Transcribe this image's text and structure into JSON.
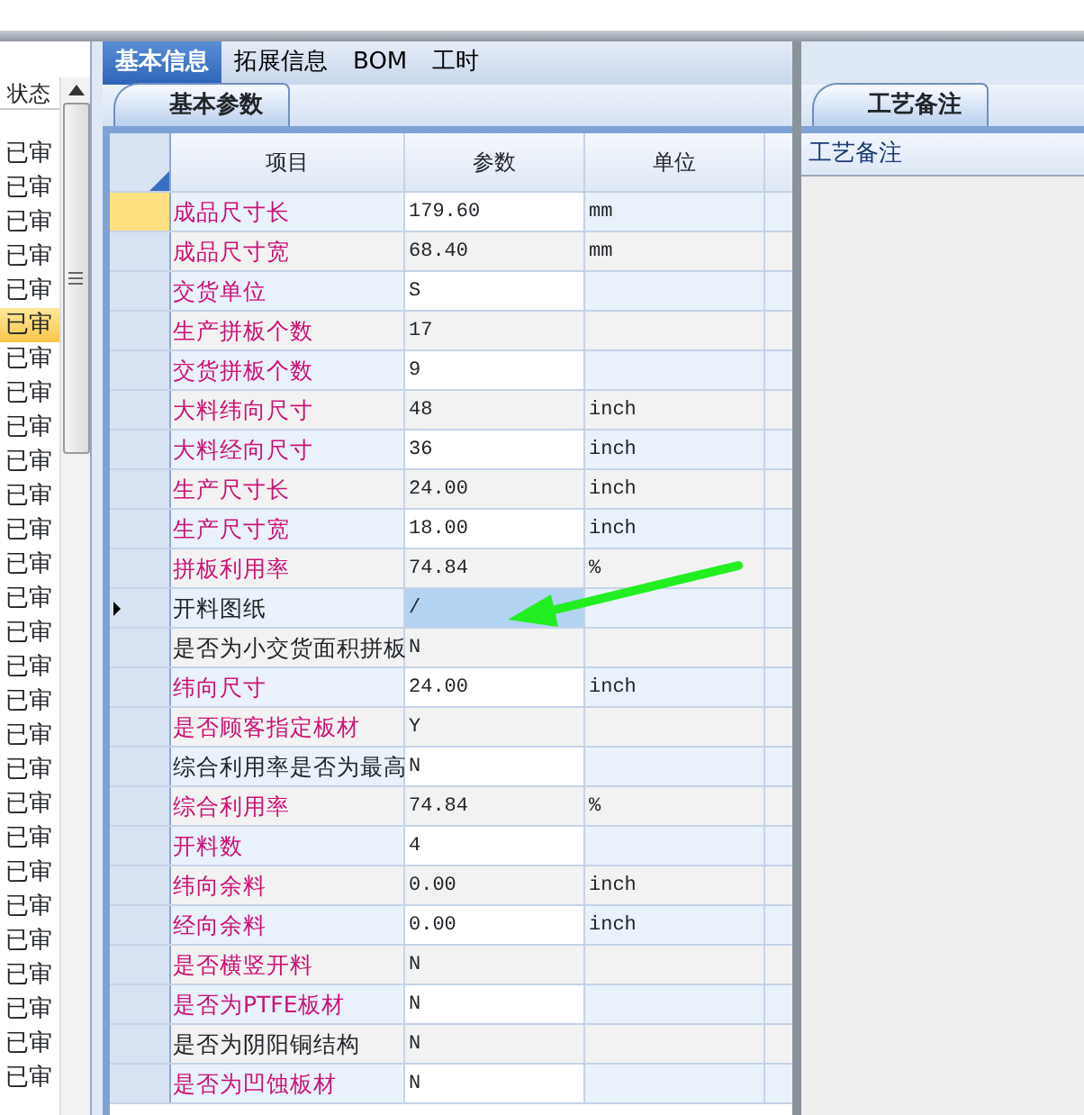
{
  "status_list": {
    "header": "状态",
    "items": [
      {
        "text": "已审",
        "selected": false
      },
      {
        "text": "已审",
        "selected": false
      },
      {
        "text": "已审",
        "selected": false
      },
      {
        "text": "已审",
        "selected": false
      },
      {
        "text": "已审",
        "selected": false
      },
      {
        "text": "已审",
        "selected": true
      },
      {
        "text": "已审",
        "selected": false
      },
      {
        "text": "已审",
        "selected": false
      },
      {
        "text": "已审",
        "selected": false
      },
      {
        "text": "已审",
        "selected": false
      },
      {
        "text": "已审",
        "selected": false
      },
      {
        "text": "已审",
        "selected": false
      },
      {
        "text": "已审",
        "selected": false
      },
      {
        "text": "已审",
        "selected": false
      },
      {
        "text": "已审",
        "selected": false
      },
      {
        "text": "已审",
        "selected": false
      },
      {
        "text": "已审",
        "selected": false
      },
      {
        "text": "已审",
        "selected": false
      },
      {
        "text": "已审",
        "selected": false
      },
      {
        "text": "已审",
        "selected": false
      },
      {
        "text": "已审",
        "selected": false
      },
      {
        "text": "已审",
        "selected": false
      },
      {
        "text": "已审",
        "selected": false
      },
      {
        "text": "已审",
        "selected": false
      },
      {
        "text": "已审",
        "selected": false
      },
      {
        "text": "已审",
        "selected": false
      },
      {
        "text": "已审",
        "selected": false
      },
      {
        "text": "已审",
        "selected": false
      }
    ]
  },
  "tabs": [
    {
      "label": "基本信息",
      "selected": true
    },
    {
      "label": "拓展信息",
      "selected": false
    },
    {
      "label": "BOM",
      "selected": false
    },
    {
      "label": "工时",
      "selected": false
    }
  ],
  "sub_tab": "基本参数",
  "table": {
    "columns": [
      "项目",
      "参数",
      "单位"
    ],
    "rows": [
      {
        "item": "成品尺寸长",
        "value": "179.60",
        "unit": "mm",
        "highlight": true,
        "hot": true,
        "selected": false
      },
      {
        "item": "成品尺寸宽",
        "value": "68.40",
        "unit": "mm",
        "highlight": true,
        "hot": false,
        "selected": false
      },
      {
        "item": "交货单位",
        "value": "S",
        "unit": "",
        "highlight": true,
        "hot": false,
        "selected": false
      },
      {
        "item": "生产拼板个数",
        "value": "17",
        "unit": "",
        "highlight": true,
        "hot": false,
        "selected": false
      },
      {
        "item": "交货拼板个数",
        "value": "9",
        "unit": "",
        "highlight": true,
        "hot": false,
        "selected": false
      },
      {
        "item": "大料纬向尺寸",
        "value": "48",
        "unit": "inch",
        "highlight": true,
        "hot": false,
        "selected": false
      },
      {
        "item": "大料经向尺寸",
        "value": "36",
        "unit": "inch",
        "highlight": true,
        "hot": false,
        "selected": false
      },
      {
        "item": "生产尺寸长",
        "value": "24.00",
        "unit": "inch",
        "highlight": true,
        "hot": false,
        "selected": false
      },
      {
        "item": "生产尺寸宽",
        "value": "18.00",
        "unit": "inch",
        "highlight": true,
        "hot": false,
        "selected": false
      },
      {
        "item": "拼板利用率",
        "value": "74.84",
        "unit": "%",
        "highlight": true,
        "hot": false,
        "selected": false
      },
      {
        "item": "开料图纸",
        "value": "/",
        "unit": "",
        "highlight": false,
        "hot": false,
        "selected": true
      },
      {
        "item": "是否为小交货面积拼板",
        "value": "N",
        "unit": "",
        "highlight": false,
        "hot": false,
        "selected": false
      },
      {
        "item": "纬向尺寸",
        "value": "24.00",
        "unit": "inch",
        "highlight": true,
        "hot": false,
        "selected": false
      },
      {
        "item": "是否顾客指定板材",
        "value": "Y",
        "unit": "",
        "highlight": true,
        "hot": false,
        "selected": false
      },
      {
        "item": "综合利用率是否为最高",
        "value": "N",
        "unit": "",
        "highlight": false,
        "hot": false,
        "selected": false
      },
      {
        "item": "综合利用率",
        "value": "74.84",
        "unit": "%",
        "highlight": true,
        "hot": false,
        "selected": false
      },
      {
        "item": "开料数",
        "value": "4",
        "unit": "",
        "highlight": true,
        "hot": false,
        "selected": false
      },
      {
        "item": "纬向余料",
        "value": "0.00",
        "unit": "inch",
        "highlight": true,
        "hot": false,
        "selected": false
      },
      {
        "item": "经向余料",
        "value": "0.00",
        "unit": "inch",
        "highlight": true,
        "hot": false,
        "selected": false
      },
      {
        "item": "是否横竖开料",
        "value": "N",
        "unit": "",
        "highlight": true,
        "hot": false,
        "selected": false
      },
      {
        "item": "是否为PTFE板材",
        "value": "N",
        "unit": "",
        "highlight": true,
        "hot": false,
        "selected": false
      },
      {
        "item": "是否为阴阳铜结构",
        "value": "N",
        "unit": "",
        "highlight": false,
        "hot": false,
        "selected": false
      },
      {
        "item": "是否为凹蚀板材",
        "value": "N",
        "unit": "",
        "highlight": true,
        "hot": false,
        "selected": false
      }
    ]
  },
  "notes_panel": {
    "tab": "工艺备注",
    "header": "工艺备注"
  }
}
